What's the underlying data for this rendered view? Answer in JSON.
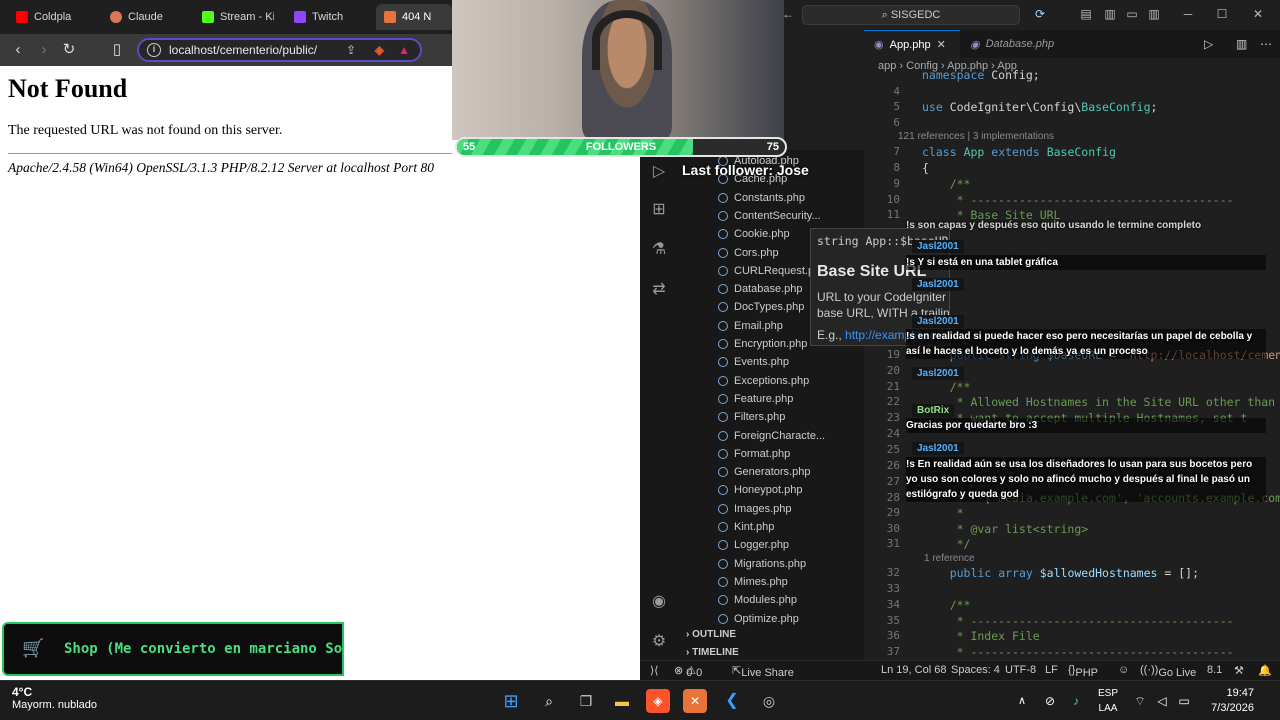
{
  "browser": {
    "tabs": [
      {
        "label": "Coldpla",
        "color": "#ff0000"
      },
      {
        "label": "Claude",
        "color": "#d97757"
      },
      {
        "label": "Stream - Ki",
        "color": "#53fc18"
      },
      {
        "label": "Twitch",
        "color": "#9146ff"
      },
      {
        "label": "404 N",
        "color": "#e8743b"
      }
    ],
    "url": "localhost/cementerio/public/",
    "page": {
      "heading": "Not Found",
      "message": "The requested URL was not found on this server.",
      "server": "Apache/2.4.58 (Win64) OpenSSL/3.1.3 PHP/8.2.12 Server at localhost Port 80"
    }
  },
  "stream": {
    "followers_low": "55",
    "followers_label": "FOLLOWERS",
    "followers_high": "75",
    "followers_progress": 0.72,
    "last_follower": "Last follower: Jose",
    "shop_text": "Shop (Me convierto en marciano Son",
    "chat": [
      {
        "user": "",
        "text": "!s son capas y después eso quito usando le termine completo"
      },
      {
        "user": "Jasl2001",
        "text": "!s Y si está en una tablet gráfica"
      },
      {
        "user": "Jasl2001",
        "text": ""
      },
      {
        "user": "Jasl2001",
        "text": "!s en realidad si puede hacer eso pero necesitarías un papel de cebolla y así le haces el boceto y lo demás ya es un proceso"
      },
      {
        "user": "Jasl2001",
        "text": ""
      },
      {
        "user": "BotRix",
        "text": "Gracias por quedarte bro :3"
      },
      {
        "user": "Jasl2001",
        "text": "!s En realidad aún se usa los diseñadores lo usan para sus bocetos pero yo uso son colores y solo no afincó mucho y después al final le pasó un estilógrafo y queda god"
      }
    ]
  },
  "vscode": {
    "search": "SISGEDC",
    "tabs": [
      {
        "label": "App.php",
        "active": true
      },
      {
        "label": "Database.php",
        "active": false
      }
    ],
    "breadcrumbs": [
      "app",
      "Config",
      "App.php",
      "App"
    ],
    "files": [
      "Autoload.php",
      "Cache.php",
      "Constants.php",
      "ContentSecurity...",
      "Cookie.php",
      "Cors.php",
      "CURLRequest.p",
      "Database.php",
      "DocTypes.php",
      "Email.php",
      "Encryption.php",
      "Events.php",
      "Exceptions.php",
      "Feature.php",
      "Filters.php",
      "ForeignCharacte...",
      "Format.php",
      "Generators.php",
      "Honeypot.php",
      "Images.php",
      "Kint.php",
      "Logger.php",
      "Migrations.php",
      "Mimes.php",
      "Modules.php",
      "Optimize.php"
    ],
    "sections": [
      "OUTLINE",
      "TIMELINE"
    ],
    "code": [
      {
        "n": "",
        "text": "namespace Config;"
      },
      {
        "n": "4",
        "text": ""
      },
      {
        "n": "5",
        "text": "use CodeIgniter\\Config\\BaseConfig;"
      },
      {
        "n": "6",
        "text": ""
      },
      {
        "n": "7",
        "text": "class App extends BaseConfig"
      },
      {
        "n": "8",
        "text": "{"
      },
      {
        "n": "9",
        "text": "    /**"
      },
      {
        "n": "10",
        "text": "     * --------------------------------------"
      },
      {
        "n": "11",
        "text": "     * Base Site URL"
      },
      {
        "n": "19",
        "text": "    public string $baseURL = 'http://localhost/cemente"
      },
      {
        "n": "20",
        "text": ""
      },
      {
        "n": "21",
        "text": "    /**"
      },
      {
        "n": "22",
        "text": "     * Allowed Hostnames in the Site URL other than th"
      },
      {
        "n": "23",
        "text": "     * want to accept multiple Hostnames, set t"
      },
      {
        "n": "24",
        "text": ""
      },
      {
        "n": "25",
        "text": ""
      },
      {
        "n": "26",
        "text": ""
      },
      {
        "n": "27",
        "text": ""
      },
      {
        "n": "28",
        "text": "     *   ['media.example.com', 'accounts.example.com"
      },
      {
        "n": "29",
        "text": "     *"
      },
      {
        "n": "30",
        "text": "     * @var list<string>"
      },
      {
        "n": "31",
        "text": "     */"
      },
      {
        "n": "32",
        "text": "    public array $allowedHostnames = [];"
      },
      {
        "n": "33",
        "text": ""
      },
      {
        "n": "34",
        "text": "    /**"
      },
      {
        "n": "35",
        "text": "     * --------------------------------------"
      },
      {
        "n": "36",
        "text": "     * Index File"
      },
      {
        "n": "37",
        "text": "     * --------------------------------------"
      }
    ],
    "lens_refs": "121 references | 3 implementations",
    "lens_one": "1 reference",
    "hover": {
      "signature": "string App::$baseURL",
      "title": "Base Site URL",
      "description": "URL to your CodeIgniter root. Typically, this will be your base URL, WITH a trailing slash:",
      "example_prefix": "E.g.,",
      "example_link": "http://example.com/"
    },
    "status": {
      "errors": "0",
      "warnings": "0",
      "live_share": "Live Share",
      "position": "Ln 19, Col 68",
      "spaces": "Spaces: 4",
      "encoding": "UTF-8",
      "eol": "LF",
      "language": "PHP",
      "go_live": "Go Live",
      "version": "8.1"
    }
  },
  "taskbar": {
    "temp": "4°C",
    "weather": "Mayorm. nublado",
    "lang1": "ESP",
    "lang2": "LAA",
    "time": "19:47",
    "date": "7/3/2026"
  }
}
